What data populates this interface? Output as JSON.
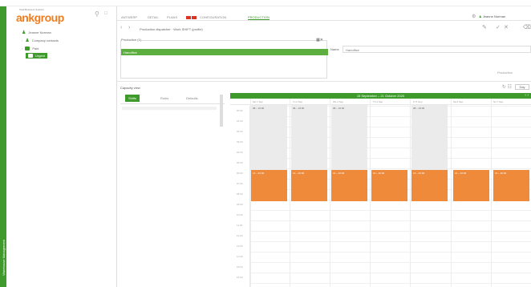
{
  "app": {
    "logo": "ankgroup",
    "logo_tagline": "Total Business Solution",
    "vertical_label": "Warehouse Management",
    "user_name": "Jeanne Norman"
  },
  "tree": {
    "items": [
      {
        "label": "Jeanne Norman"
      },
      {
        "label": "Company contacts"
      },
      {
        "label": "Paid"
      },
      {
        "label": "Urgent"
      }
    ]
  },
  "tabs": [
    {
      "label": "ANTWERP"
    },
    {
      "label": "DETAIL"
    },
    {
      "label": "PLANS"
    },
    {
      "label": "CONFIGURATION"
    },
    {
      "label": "PRODUCTION"
    }
  ],
  "toolbar": {
    "breadcrumb": "Production dispatcher · Work SHIFT (profile)"
  },
  "form": {
    "header": "Production (1)",
    "green_value": "Hanoffice",
    "name_label": "Name",
    "name_value": "Hanoffice",
    "side_label": "Production"
  },
  "section": {
    "title": "Capacity view",
    "button_label": "Day"
  },
  "subtabs": [
    {
      "label": "Shifts"
    },
    {
      "label": "Rules"
    },
    {
      "label": "Defaults"
    }
  ],
  "calendar": {
    "title": "15 September – 21 October 2020",
    "days": [
      "Mo 1 Sep",
      "Tu 2 Sep",
      "We 3 Sep",
      "Th 4 Sep",
      "Fr 5 Sep",
      "Sa 6 Sep",
      "Su 7 Sep"
    ],
    "times": [
      "00:00",
      "01:00",
      "02:00",
      "03:00",
      "04:00",
      "05:00",
      "06:00",
      "07:00",
      "08:00",
      "09:00",
      "10:00",
      "11:00",
      "12:00",
      "13:00",
      "14:00",
      "15:00",
      "16:00",
      "17:00"
    ],
    "gray_label": "08 – 16:00",
    "orange_label": "16 – 20:00",
    "colors": {
      "green": "#3e9a2a",
      "orange": "#ef8a3b",
      "gray": "#ebebeb"
    }
  }
}
